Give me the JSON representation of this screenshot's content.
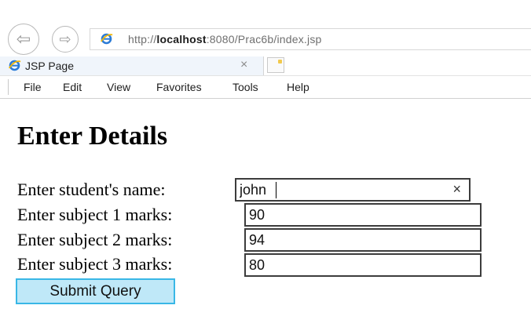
{
  "browser": {
    "url_prefix": "http://",
    "url_host": "localhost",
    "url_rest": ":8080/Prac6b/index.jsp",
    "tab_title": "JSP Page",
    "tab_close": "×",
    "menu": [
      "File",
      "Edit",
      "View",
      "Favorites",
      "Tools",
      "Help"
    ]
  },
  "page": {
    "heading": "Enter Details",
    "fields": [
      {
        "label": "Enter student's name:",
        "value": "john"
      },
      {
        "label": "Enter subject 1 marks:",
        "value": "90"
      },
      {
        "label": "Enter subject 2 marks:",
        "value": "94"
      },
      {
        "label": "Enter subject 3 marks:",
        "value": "80"
      }
    ],
    "clear_symbol": "×",
    "submit_label": "Submit Query"
  },
  "icons": [
    "back-arrow-icon",
    "forward-arrow-icon",
    "ie-logo-icon",
    "new-tab-icon",
    "close-icon",
    "clear-icon"
  ],
  "colors": {
    "button_bg": "#bfe8f8",
    "button_border": "#39b7e6",
    "ie_blue": "#2b7bd6"
  }
}
